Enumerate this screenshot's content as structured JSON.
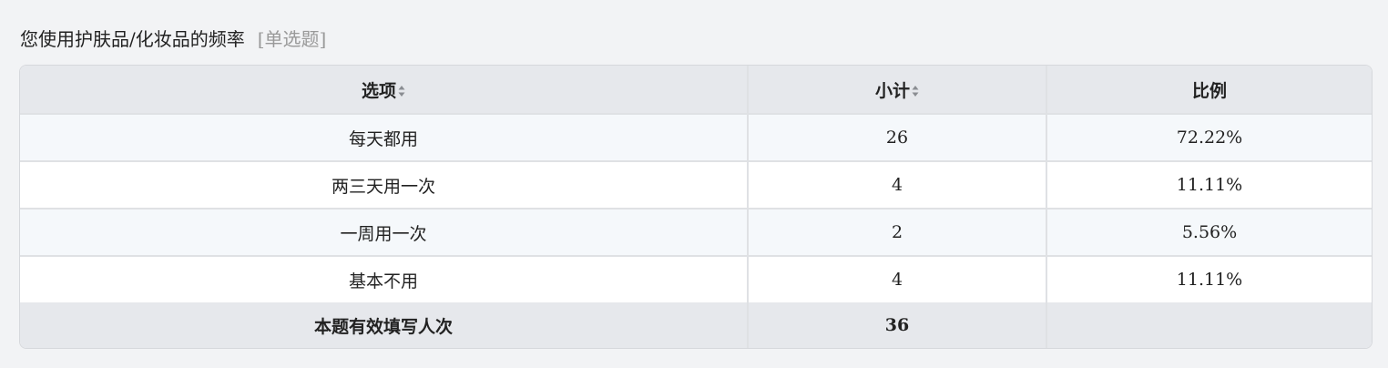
{
  "question": {
    "title": "您使用护肤品/化妆品的频率",
    "type": "[单选题]"
  },
  "table": {
    "headers": {
      "option": "选项",
      "count": "小计",
      "ratio": "比例"
    },
    "rows": [
      {
        "option": "每天都用",
        "count": "26",
        "ratio": "72.22%"
      },
      {
        "option": "两三天用一次",
        "count": "4",
        "ratio": "11.11%"
      },
      {
        "option": "一周用一次",
        "count": "2",
        "ratio": "5.56%"
      },
      {
        "option": "基本不用",
        "count": "4",
        "ratio": "11.11%"
      }
    ],
    "footer": {
      "label": "本题有效填写人次",
      "count": "36",
      "ratio": ""
    }
  },
  "icons": {
    "sort": "sort-icon"
  },
  "colors": {
    "header_bg": "#e6e8ec",
    "odd_row_bg": "#f5f8fb",
    "even_row_bg": "#ffffff",
    "border": "#dfe1e4",
    "muted_text": "#999999"
  }
}
